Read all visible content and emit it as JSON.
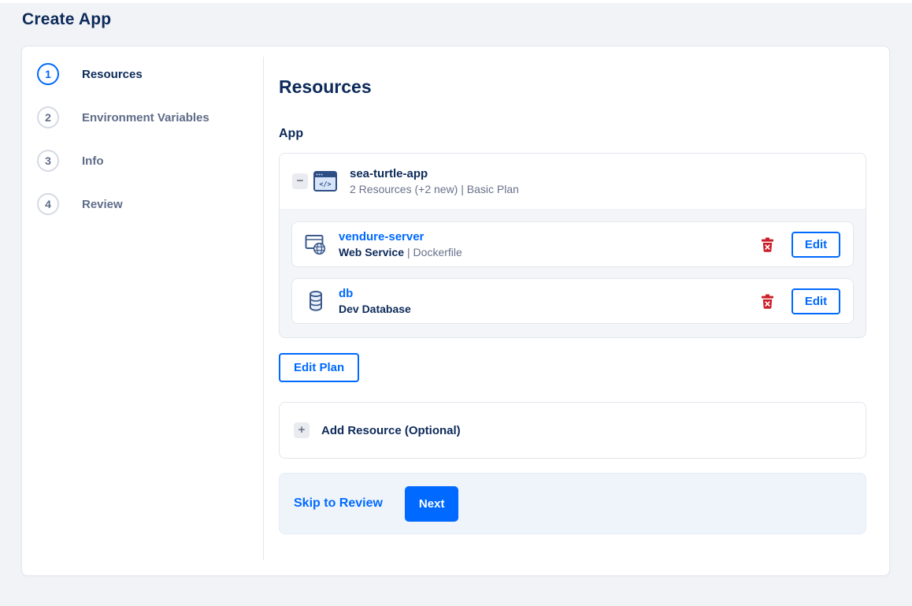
{
  "page": {
    "title": "Create App"
  },
  "stepper": [
    {
      "number": "1",
      "label": "Resources"
    },
    {
      "number": "2",
      "label": "Environment Variables"
    },
    {
      "number": "3",
      "label": "Info"
    },
    {
      "number": "4",
      "label": "Review"
    }
  ],
  "main": {
    "heading": "Resources",
    "section_label": "App",
    "app_group": {
      "name": "sea-turtle-app",
      "summary": "2 Resources (+2 new) | Basic Plan",
      "resources": [
        {
          "name": "vendure-server",
          "type": "Web Service",
          "detail": "| Dockerfile",
          "icon": "web-service-icon"
        },
        {
          "name": "db",
          "type": "Dev Database",
          "detail": "",
          "icon": "database-icon"
        }
      ]
    }
  },
  "labels": {
    "edit": "Edit",
    "edit_plan": "Edit Plan",
    "add_resource": "Add Resource (Optional)",
    "skip": "Skip to Review",
    "next": "Next"
  },
  "icons": {
    "collapse_glyph": "−",
    "add_glyph": "+",
    "app": "code-window-icon",
    "web_service": "browser-globe-icon",
    "database": "database-cylinder-icon",
    "delete": "trash-icon"
  },
  "colors": {
    "accent": "#0069ff",
    "navy": "#0d2a5a",
    "muted": "#67718a",
    "danger": "#cb1e28"
  }
}
